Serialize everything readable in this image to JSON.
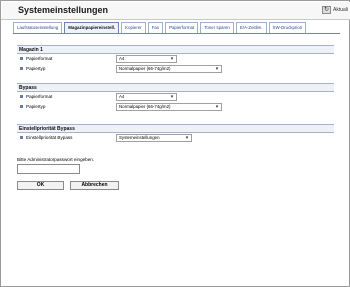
{
  "header": {
    "title": "Systemeinstellungen",
    "refresh_label": "Aktuali"
  },
  "tabs": [
    {
      "label": "Laufstatuseinstellung",
      "active": false
    },
    {
      "label": "Magazinpapiereinstell.",
      "active": true
    },
    {
      "label": "Kopierer",
      "active": false
    },
    {
      "label": "Fax",
      "active": false
    },
    {
      "label": "Papierformat",
      "active": false
    },
    {
      "label": "Toner sparen",
      "active": false
    },
    {
      "label": "E/A-Zeitlim.",
      "active": false
    },
    {
      "label": "SW-Druckpriori",
      "active": false
    }
  ],
  "magazin1": {
    "title": "Magazin 1",
    "format_label": "Papierformat",
    "format_value": "A4",
    "type_label": "Papiertyp",
    "type_value": "Normalpapier (66-74g/m2)"
  },
  "bypass": {
    "title": "Bypass",
    "format_label": "Papierformat",
    "format_value": "A4",
    "type_label": "Papiertyp",
    "type_value": "Normalpapier (66-74g/m2)"
  },
  "prio": {
    "title": "Einstellpriorität Bypass",
    "label": "Einstellpriorität Bypass",
    "value": "Systemeinstellungen"
  },
  "password": {
    "label": "Bitte Administratorpasswort eingeben.",
    "value": ""
  },
  "buttons": {
    "ok": "OK",
    "cancel": "Abbrechen"
  }
}
